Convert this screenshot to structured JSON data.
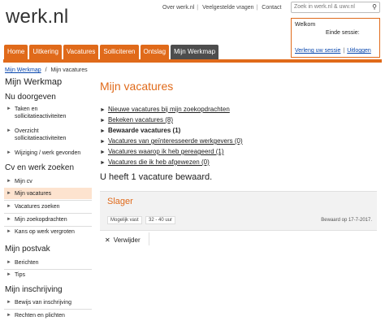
{
  "header": {
    "logo": "werk.nl",
    "toplinks": [
      "Over werk.nl",
      "Veelgestelde vragen",
      "Contact"
    ],
    "search_placeholder": "Zoek in werk.nl & uwv.nl",
    "welcome": {
      "title": "Welkom",
      "session": "Einde sessie:",
      "extend": "Verleng uw sessie",
      "logout": "Uitloggen"
    }
  },
  "nav": {
    "tabs": [
      "Home",
      "Uitkering",
      "Vacatures",
      "Solliciteren",
      "Ontslag",
      "Mijn Werkmap"
    ],
    "active": "Mijn Werkmap"
  },
  "breadcrumb": {
    "home": "Mijn Werkmap",
    "separator": "/",
    "current": "Mijn vacatures"
  },
  "sidebar": {
    "title": "Mijn Werkmap",
    "sections": [
      {
        "title": "Nu doorgeven",
        "items": [
          "Taken en sollicitatieactiviteiten",
          "Overzicht sollicitatieactiviteiten",
          "Wijziging / werk gevonden"
        ]
      },
      {
        "title": "Cv en werk zoeken",
        "items": [
          "Mijn cv",
          "Mijn vacatures",
          "Vacatures zoeken",
          "Mijn zoekopdrachten",
          "Kans op werk vergroten"
        ]
      },
      {
        "title": "Mijn postvak",
        "items": [
          "Berichten",
          "Tips"
        ]
      },
      {
        "title": "Mijn inschrijving",
        "items": [
          "Bewijs van inschrijving",
          "Rechten en plichten"
        ]
      }
    ],
    "active_item": "Mijn vacatures"
  },
  "main": {
    "title": "Mijn vacatures",
    "links": [
      "Nieuwe vacatures bij mijn zoekopdrachten",
      "Bekeken vacatures (8)",
      "Bewaarde vacatures (1)",
      "Vacatures van geïnteresseerde werkgevers (0)",
      "Vacatures waarop ik heb gereageerd (1)",
      "Vacatures die ik heb afgewezen (0)"
    ],
    "saved_text": "U heeft 1 vacature bewaard.",
    "vacancy": {
      "title": "Slager",
      "tags": [
        "Mogelijk vast",
        "32 - 40 uur"
      ],
      "saved_date": "Bewaard op 17-7-2017."
    },
    "remove_label": "Verwijder"
  },
  "colors": {
    "accent": "#e06a1a",
    "active_tab": "#4d4d4d",
    "active_sidebar": "#fde3cf",
    "link": "#0645ad"
  }
}
